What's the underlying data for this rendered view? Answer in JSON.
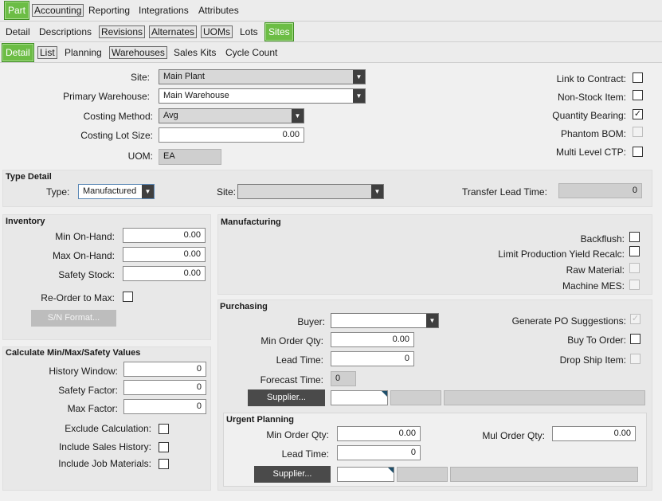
{
  "tabs1": {
    "part": "Part",
    "accounting": "Accounting",
    "reporting": "Reporting",
    "integrations": "Integrations",
    "attributes": "Attributes"
  },
  "tabs2": {
    "detail": "Detail",
    "descriptions": "Descriptions",
    "revisions": "Revisions",
    "alternates": "Alternates",
    "uoms": "UOMs",
    "lots": "Lots",
    "sites": "Sites"
  },
  "tabs3": {
    "detail": "Detail",
    "list": "List",
    "planning": "Planning",
    "warehouses": "Warehouses",
    "sales_kits": "Sales Kits",
    "cycle_count": "Cycle Count"
  },
  "top": {
    "site_label": "Site:",
    "site_value": "Main Plant",
    "primary_wh_label": "Primary Warehouse:",
    "primary_wh_value": "Main Warehouse",
    "costing_method_label": "Costing Method:",
    "costing_method_value": "Avg",
    "costing_lot_label": "Costing Lot Size:",
    "costing_lot_value": "0.00",
    "uom_label": "UOM:",
    "uom_value": "EA",
    "link_contract": "Link to Contract:",
    "non_stock": "Non-Stock Item:",
    "qty_bearing": "Quantity Bearing:",
    "phantom_bom": "Phantom BOM:",
    "multi_ctp": "Multi Level CTP:"
  },
  "type_detail": {
    "title": "Type Detail",
    "type_label": "Type:",
    "type_value": "Manufactured",
    "site_label": "Site:",
    "transfer_label": "Transfer Lead Time:",
    "transfer_value": "0"
  },
  "inventory": {
    "title": "Inventory",
    "min_label": "Min On-Hand:",
    "min_value": "0.00",
    "max_label": "Max On-Hand:",
    "max_value": "0.00",
    "safety_label": "Safety Stock:",
    "safety_value": "0.00",
    "reorder_label": "Re-Order to Max:",
    "sn_button": "S/N Format..."
  },
  "calc": {
    "title": "Calculate Min/Max/Safety Values",
    "history_label": "History Window:",
    "history_value": "0",
    "safety_factor_label": "Safety Factor:",
    "safety_factor_value": "0",
    "max_factor_label": "Max Factor:",
    "max_factor_value": "0",
    "exclude_label": "Exclude Calculation:",
    "sales_history_label": "Include Sales History:",
    "job_materials_label": "Include Job Materials:"
  },
  "manufacturing": {
    "title": "Manufacturing",
    "backflush": "Backflush:",
    "limit_yield": "Limit Production Yield Recalc:",
    "raw_material": "Raw Material:",
    "machine_mes": "Machine MES:"
  },
  "purchasing": {
    "title": "Purchasing",
    "buyer_label": "Buyer:",
    "min_order_label": "Min Order Qty:",
    "min_order_value": "0.00",
    "lead_time_label": "Lead Time:",
    "lead_time_value": "0",
    "forecast_label": "Forecast Time:",
    "forecast_value": "0",
    "supplier_button": "Supplier...",
    "gen_po": "Generate PO Suggestions:",
    "buy_to_order": "Buy To Order:",
    "drop_ship": "Drop Ship Item:"
  },
  "urgent": {
    "title": "Urgent Planning",
    "min_order_label": "Min Order Qty:",
    "min_order_value": "0.00",
    "mul_order_label": "Mul Order Qty:",
    "mul_order_value": "0.00",
    "lead_time_label": "Lead Time:",
    "lead_time_value": "0",
    "supplier_button": "Supplier..."
  },
  "colors": {
    "active_tab": "#6cbd45",
    "dark_button": "#4a4a4a"
  }
}
